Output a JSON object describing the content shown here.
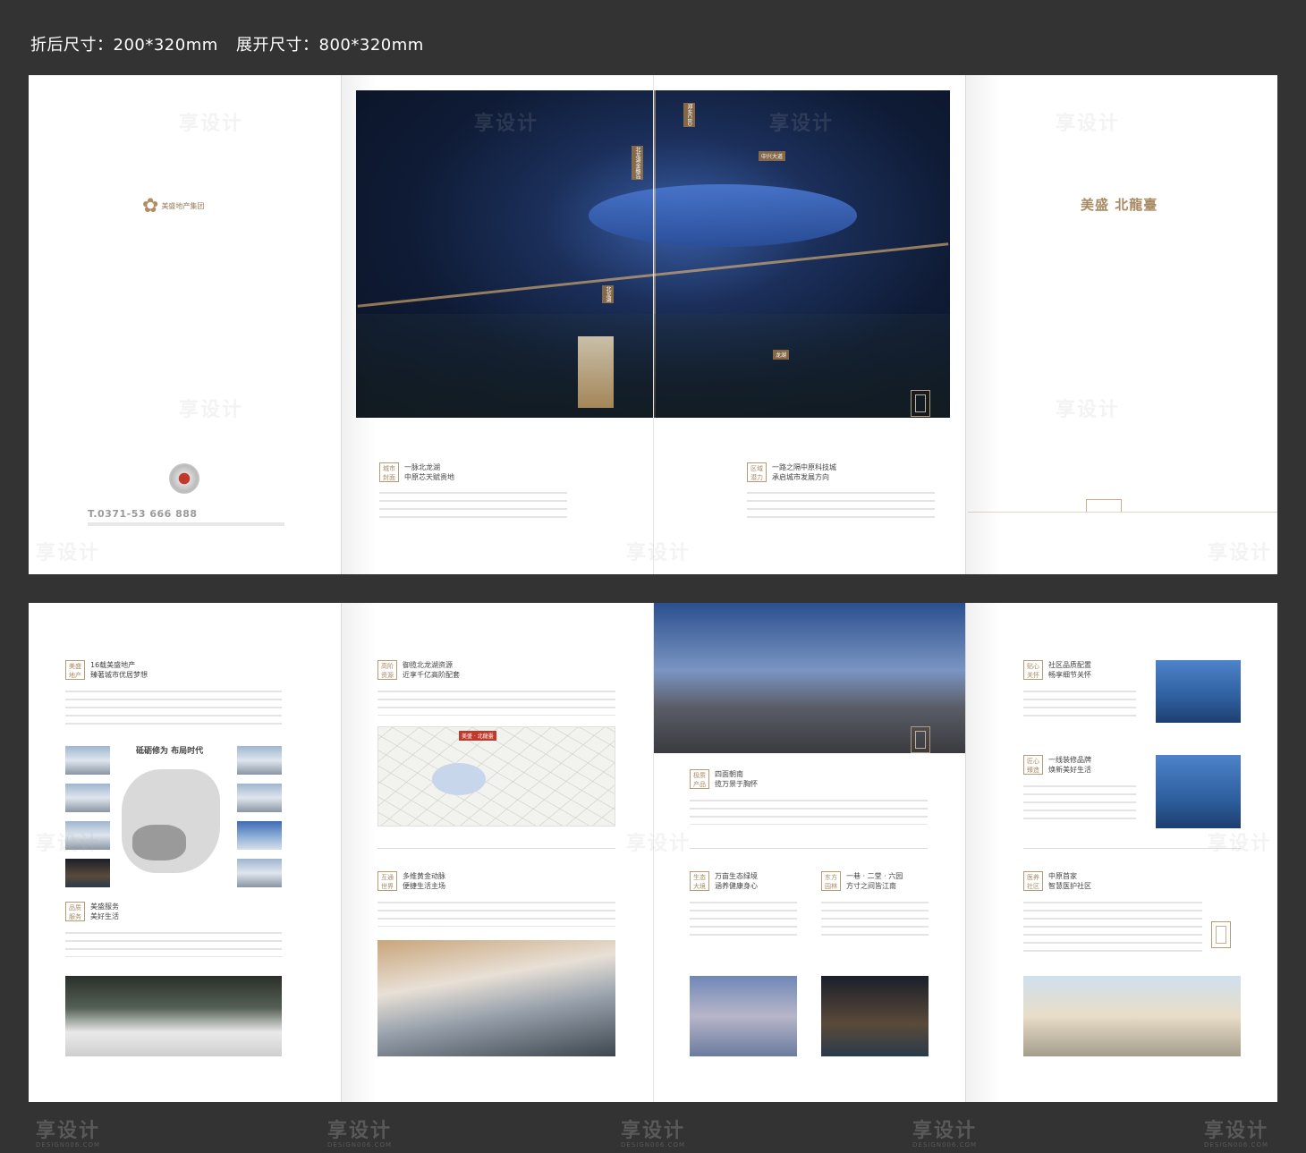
{
  "header": {
    "folded_size": "折后尺寸：200*320mm",
    "unfolded_size": "展开尺寸：800*320mm"
  },
  "cover": {
    "group_logo_text": "美盛地产集团",
    "hotline": "T.0371-53 666 888",
    "project_logo": "美盛 北龍臺"
  },
  "top_left": {
    "tag_mark": [
      "城市",
      "封面"
    ],
    "title_1": "一脉北龙湖",
    "title_2": "中原芯天赋贵地"
  },
  "top_right": {
    "tag_mark": [
      "区域",
      "潜力"
    ],
    "title_1": "一路之隔中原科技城",
    "title_2": "承启城市发展方向"
  },
  "aerial_labels": [
    "郑东CBD",
    "北龙湖金融岛",
    "中兴大道",
    "北龙湖",
    "龙湖"
  ],
  "b1": {
    "tag1_mark": [
      "美盛",
      "地产"
    ],
    "tag1_title_1": "16载美盛地产",
    "tag1_title_2": "臻著城市优居梦想",
    "map_title": "砥砺修为  布局时代",
    "tag2_mark": [
      "品质",
      "服务"
    ],
    "tag2_title_1": "美盛服务",
    "tag2_title_2": "美好生活"
  },
  "b2": {
    "tag1_mark": [
      "高阶",
      "资源"
    ],
    "tag1_title_1": "御揽北龙湖资源",
    "tag1_title_2": "近享千亿高阶配套",
    "map_label_1": "美盛 · 北龍臺",
    "tag2_mark": [
      "互通",
      "世界"
    ],
    "tag2_title_1": "多维黄金动脉",
    "tag2_title_2": "便捷生活主场"
  },
  "b3": {
    "tag1_mark": [
      "极质",
      "产品"
    ],
    "tag1_title_1": "四面朝南",
    "tag1_title_2": "揽万景于胸怀",
    "tag2_mark": [
      "生态",
      "大境"
    ],
    "tag2_title_1": "万亩生态绿境",
    "tag2_title_2": "涵养健康身心",
    "tag3_mark": [
      "东方",
      "园林"
    ],
    "tag3_title_1": "一巷 · 二堂 · 六园",
    "tag3_title_2": "方寸之间皆江南"
  },
  "b4": {
    "tag1_mark": [
      "贴心",
      "关怀"
    ],
    "tag1_title_1": "社区品质配置",
    "tag1_title_2": "畅享细节关怀",
    "tag2_mark": [
      "匠心",
      "臻造"
    ],
    "tag2_title_1": "一线装修品牌",
    "tag2_title_2": "焕新美好生活",
    "tag3_mark": [
      "医养",
      "社区"
    ],
    "tag3_title_1": "中原首家",
    "tag3_title_2": "智慧医护社区"
  },
  "watermark": {
    "brand": "享设计",
    "site": "DESIGN006.COM"
  },
  "colors": {
    "background": "#333333",
    "gold": "#a88a63",
    "paper": "#ffffff"
  }
}
